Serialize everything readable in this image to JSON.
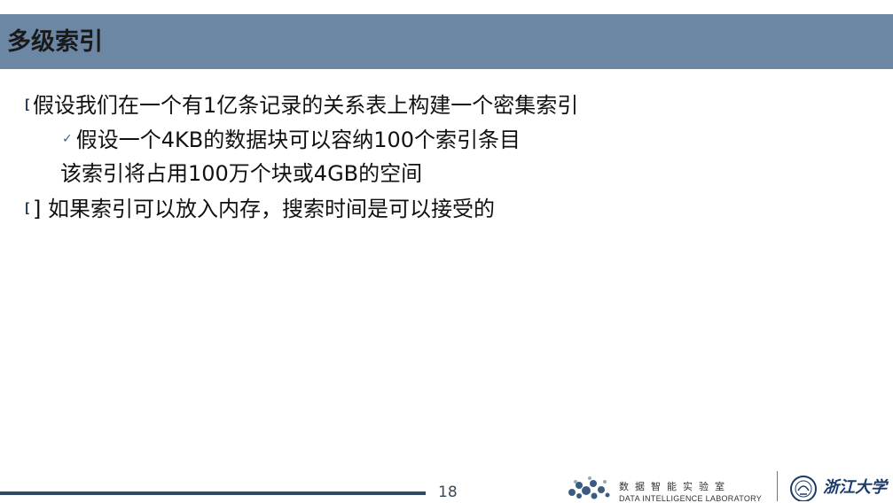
{
  "slide": {
    "title": "多级索引",
    "bullets": [
      {
        "marker": "[",
        "text": "假设我们在一个有1亿条记录的关系表上构建一个密集索引"
      },
      {
        "marker": "✓",
        "text": "假设一个4KB的数据块可以容纳100个索引条目"
      },
      {
        "marker": "",
        "text": "该索引将占用100万个块或4GB的空间"
      },
      {
        "marker": "[",
        "text": "] 如果索引可以放入内存，搜索时间是可以接受的"
      }
    ],
    "page_number": "18"
  },
  "footer": {
    "lab_name_cn": "数据智能实验室",
    "lab_name_en": "DATA INTELLIGENCE LABORATORY",
    "university_name": "浙江大学"
  },
  "colors": {
    "title_bar": "#6b87a3",
    "footer_line": "#2f4a66"
  }
}
